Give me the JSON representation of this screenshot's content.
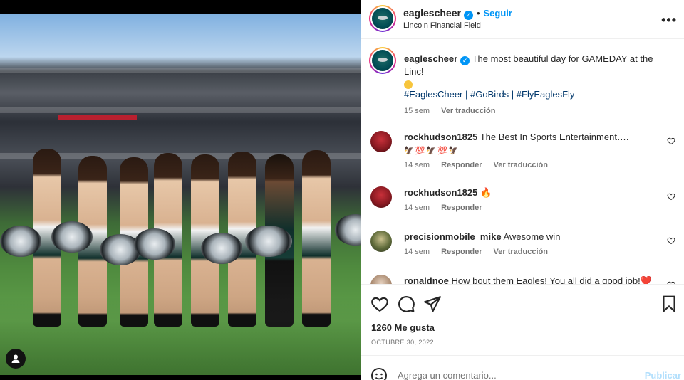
{
  "post": {
    "username": "eaglescheer",
    "follow_label": "Seguir",
    "location": "Lincoln Financial Field",
    "dot": "•",
    "more_label": "•••"
  },
  "caption": {
    "username": "eaglescheer",
    "text": "The most beautiful day for GAMEDAY at the Linc!",
    "hashtags": "#EaglesCheer | #GoBirds | #FlyEaglesFly",
    "time": "15 sem",
    "translate": "Ver traducción"
  },
  "comments": [
    {
      "username": "rockhudson1825",
      "text": "The Best In Sports Entertainment….",
      "extra": "🦅💯🦅💯🦅",
      "time": "14 sem",
      "reply": "Responder",
      "translate": "Ver traducción"
    },
    {
      "username": "rockhudson1825",
      "text": "🔥",
      "time": "14 sem",
      "reply": "Responder"
    },
    {
      "username": "precisionmobile_mike",
      "text": "Awesome win",
      "time": "14 sem",
      "reply": "Responder",
      "translate": "Ver traducción"
    },
    {
      "username": "ronaldnoe",
      "text": "How bout them Eagles! You all did a good job!❤️"
    }
  ],
  "stats": {
    "likes": "1260 Me gusta",
    "date": "OCTUBRE 30, 2022"
  },
  "composer": {
    "placeholder": "Agrega un comentario...",
    "post_label": "Publicar"
  },
  "colors": {
    "accent": "#0095f6",
    "hashtag": "#00376b",
    "muted": "#737373"
  }
}
